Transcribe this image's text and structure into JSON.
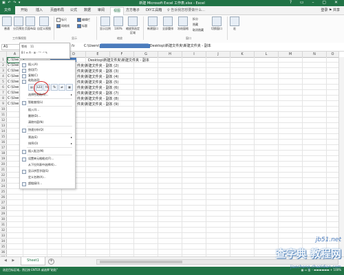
{
  "titlebar": {
    "title": "新建 Microsoft Excel 工作表.xlsx - Excel",
    "qat": "▣ ↶ ↷ ▾",
    "window_buttons": "? ▭ – ▢ ✕"
  },
  "tabs": [
    "文件",
    "开始",
    "插入",
    "页面布局",
    "公式",
    "数据",
    "审阅",
    "视图",
    "方方格子",
    "DIY工具箱"
  ],
  "search_placeholder": "♀ 告诉我您想要做什么...",
  "login": "登录  ⚑ 共享",
  "ribbon": {
    "groups": [
      "工作簿视图",
      "显示",
      "缩放",
      "窗口"
    ],
    "view_buttons": [
      "普通",
      "分页预览",
      "页面布局",
      "自定义视图"
    ],
    "show_options": [
      {
        "label": "标尺",
        "checked": false
      },
      {
        "label": "编辑栏",
        "checked": true
      },
      {
        "label": "网格线",
        "checked": true
      },
      {
        "label": "标题",
        "checked": true
      }
    ],
    "zoom_buttons": [
      "显示比例",
      "100%",
      "缩放到选定区域"
    ],
    "window_buttons": [
      "新建窗口",
      "全部重排",
      "冻结窗格"
    ],
    "window_small": [
      "拆分",
      "隐藏",
      "取消隐藏"
    ],
    "switch": "切换窗口",
    "macro": "宏"
  },
  "formula_bar": {
    "name_box": "A1",
    "fx": "fx",
    "formula_prefix": "C:\\Users\\",
    "formula_hidden": "██████████████████",
    "formula_suffix": "Desktop\\新建文件夹\\新建文件夹 - 副本"
  },
  "mini_toolbar": {
    "font": "等线",
    "size": "11",
    "row2": "B  I  ≡  A  ·  ⊞  ·  ⁺⁰ ⁻⁰  ✎"
  },
  "columns": [
    "A",
    "B",
    "C",
    "D",
    "E",
    "F",
    "G",
    "H",
    "I",
    "J",
    "K",
    "L",
    "M",
    "N",
    "O",
    "P",
    "Q"
  ],
  "rows": [
    "1",
    "2",
    "3",
    "4",
    "5",
    "6",
    "7",
    "8",
    "9",
    "10",
    "11",
    "12",
    "13",
    "14",
    "15",
    "16",
    "17",
    "18",
    "19",
    "20",
    "21",
    "22",
    "23",
    "24",
    "25",
    "26",
    "27",
    "28",
    "29",
    "30",
    "31",
    "32",
    "33",
    "34",
    "35",
    "36",
    "37"
  ],
  "cells_a": [
    "C:\\Use",
    "C:\\Use",
    "C:\\Use",
    "C:\\Use",
    "C:\\Use",
    "C:\\Use",
    "C:\\Use",
    "C:\\Use",
    "C:\\Use"
  ],
  "cells_d": [
    "Desktop\\新建文件夹\\新建文件夹 - 副本",
    "件夹\\新建文件夹 - 副本 (2)",
    "件夹\\新建文件夹 - 副本 (3)",
    "件夹\\新建文件夹 - 副本 (4)",
    "件夹\\新建文件夹 - 副本 (5)",
    "件夹\\新建文件夹 - 副本 (6)",
    "件夹\\新建文件夹 - 副本 (7)",
    "件夹\\新建文件夹 - 副本 (8)",
    "件夹\\新建文件夹 - 副本 (9)"
  ],
  "context_menu": {
    "cut": "剪切(T)",
    "copy": "复制(C)",
    "paste_options": "粘贴选项:",
    "paste_btns": [
      "▤",
      "123",
      "fx",
      "%",
      "⇄",
      "▦"
    ],
    "paste_special": "选择性粘贴(S)...",
    "smart_lookup": "智能查找(L)",
    "insert": "插入(I)...",
    "delete": "删除(D)...",
    "clear": "清除内容(N)",
    "quick_analysis": "快速分析(Q)",
    "filter": "筛选(E)",
    "sort": "排序(O)",
    "insert_comment": "插入批注(M)",
    "format_cells": "设置单元格格式(F)...",
    "pick_list": "从下拉列表中选择(K)...",
    "phonetic": "显示拼音字段(S)",
    "define_name": "定义名称(A)...",
    "hyperlink": "超链接(I)...",
    "top_item": "插入(A)"
  },
  "sheet": {
    "tab": "Sheet1",
    "add": "+",
    "nav": "◀ ▶"
  },
  "status": {
    "text": "选定目标区域，然后按 ENTER 或选择“粘贴”",
    "zoom": "▦ ▭ ▥  –  ▬▬▬▬▬▬  +  100%"
  },
  "watermark": {
    "site": "jb51.net",
    "big": "查字典 教程网",
    "url": "jiaocheng.chazidian.com"
  },
  "colors": {
    "excel_green": "#217346",
    "selection_blue": "#4a7bbd",
    "highlight_red": "#d42121"
  }
}
